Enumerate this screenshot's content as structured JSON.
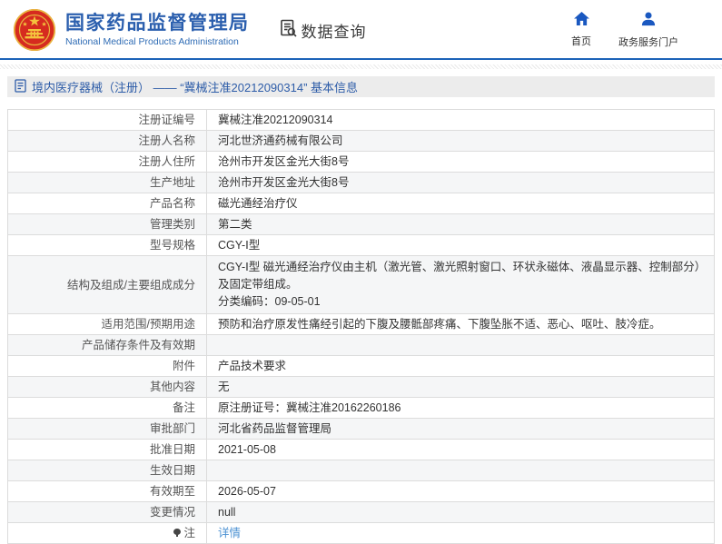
{
  "header": {
    "org_title": "国家药品监督管理局",
    "org_subtitle": "National Medical Products Administration",
    "data_query_label": "数据查询",
    "nav": [
      {
        "label": "首页",
        "icon": "home-icon"
      },
      {
        "label": "政务服务门户",
        "icon": "user-icon"
      }
    ],
    "accent_blue": "#1c63b8",
    "title_blue": "#2b5fae"
  },
  "breadcrumb": {
    "text": "境内医疗器械（注册） —— “冀械注准20212090314” 基本信息"
  },
  "table": {
    "rows": [
      {
        "label": "注册证编号",
        "value": "冀械注准20212090314"
      },
      {
        "label": "注册人名称",
        "value": "河北世济通药械有限公司"
      },
      {
        "label": "注册人住所",
        "value": "沧州市开发区金光大街8号"
      },
      {
        "label": "生产地址",
        "value": "沧州市开发区金光大街8号"
      },
      {
        "label": "产品名称",
        "value": "磁光通经治疗仪"
      },
      {
        "label": "管理类别",
        "value": "第二类"
      },
      {
        "label": "型号规格",
        "value": "CGY-Ⅰ型"
      },
      {
        "label": "结构及组成/主要组成成分",
        "value_lines": [
          "CGY-Ⅰ型 磁光通经治疗仪由主机（激光管、激光照射窗口、环状永磁体、液晶显示器、控制部分）及固定带组成。",
          "分类编码：09-05-01"
        ]
      },
      {
        "label": "适用范围/预期用途",
        "value": "预防和治疗原发性痛经引起的下腹及腰骶部疼痛、下腹坠胀不适、恶心、呕吐、肢冷症。"
      },
      {
        "label": "产品储存条件及有效期",
        "value": ""
      },
      {
        "label": "附件",
        "value": "产品技术要求"
      },
      {
        "label": "其他内容",
        "value": "无"
      },
      {
        "label": "备注",
        "value": "原注册证号：冀械注准20162260186"
      },
      {
        "label": "审批部门",
        "value": "河北省药品监督管理局"
      },
      {
        "label": "批准日期",
        "value": "2021-05-08"
      },
      {
        "label": "生效日期",
        "value": ""
      },
      {
        "label": "有效期至",
        "value": "2026-05-07"
      },
      {
        "label": "变更情况",
        "value": "null"
      },
      {
        "label": "注",
        "value": "详情",
        "is_link": true,
        "has_icon": true
      }
    ],
    "link_color": "#4a90d2",
    "alt_row_color": "#f5f6f7"
  }
}
